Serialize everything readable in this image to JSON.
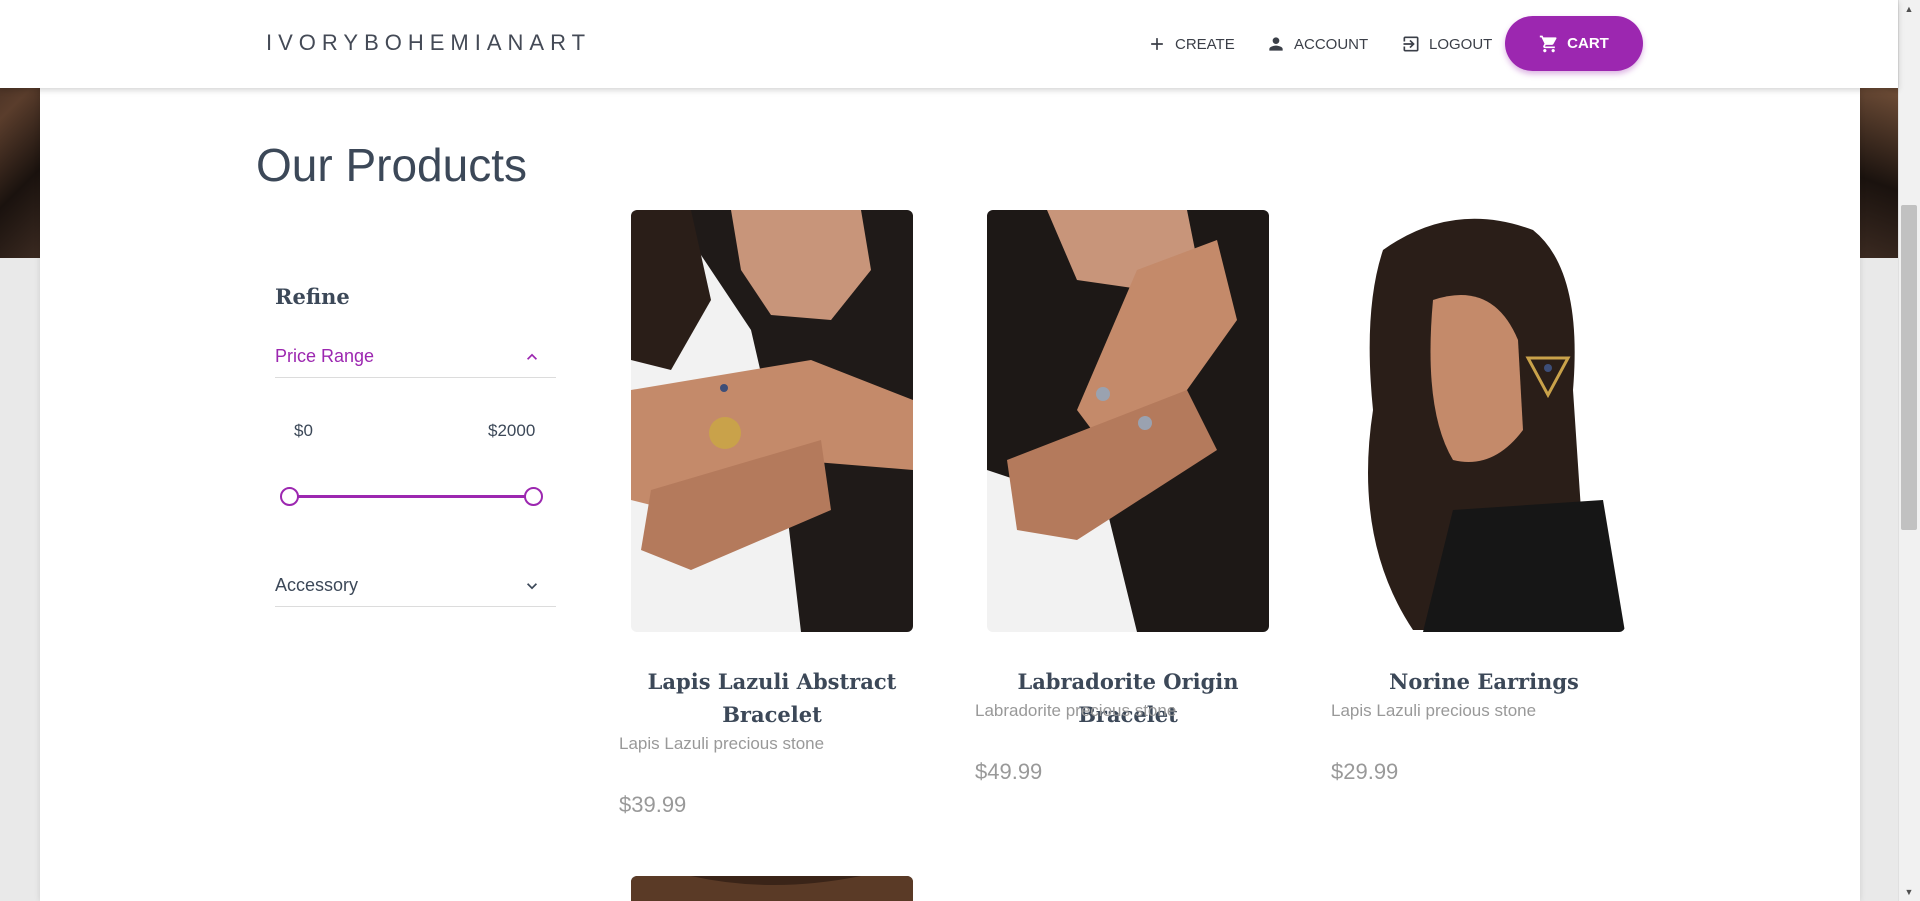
{
  "header": {
    "brand": "IVORYBOHEMIANART",
    "nav": {
      "create": "CREATE",
      "account": "ACCOUNT",
      "logout": "LOGOUT",
      "cart": "CART"
    }
  },
  "page_title": "Our Products",
  "refine": {
    "title": "Refine",
    "price_range": {
      "label": "Price Range",
      "min_label": "$0",
      "max_label": "$2000",
      "min_value": 0,
      "max_value": 2000,
      "expanded": true
    },
    "accessory": {
      "label": "Accessory",
      "expanded": false
    }
  },
  "products": [
    {
      "name": "Lapis Lazuli Abstract Bracelet",
      "description": "Lapis Lazuli precious stone",
      "price": "$39.99"
    },
    {
      "name": "Labradorite Origin Bracelet",
      "description": "Labradorite precious stone",
      "price": "$49.99"
    },
    {
      "name": "Norine Earrings",
      "description": "Lapis Lazuli precious stone",
      "price": "$29.99"
    }
  ],
  "colors": {
    "accent": "#9c27b0",
    "text": "#3c4858",
    "muted": "#999999"
  }
}
